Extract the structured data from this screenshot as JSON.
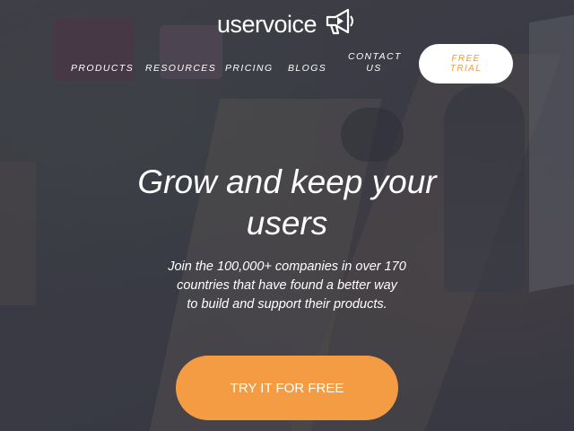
{
  "brand": {
    "name": "uservoice",
    "logo_icon": "megaphone-icon"
  },
  "nav": {
    "products": "PRODUCTS",
    "resources": "RESOURCES",
    "pricing": "PRICING",
    "blogs": "BLOGS",
    "contact_line1": "CONTACT",
    "contact_line2": "US",
    "trial_line1": "FREE",
    "trial_line2": "TRIAL"
  },
  "hero": {
    "title_line1": "Grow and keep your",
    "title_line2": "users",
    "subtitle_line1": "Join the 100,000+ companies in over 170",
    "subtitle_line2": "countries that have found a better way",
    "subtitle_line3": "to build and support their products.",
    "cta_label": "TRY IT FOR FREE"
  },
  "colors": {
    "accent": "#f39c44",
    "overlay": "#343642",
    "text": "#ffffff"
  }
}
